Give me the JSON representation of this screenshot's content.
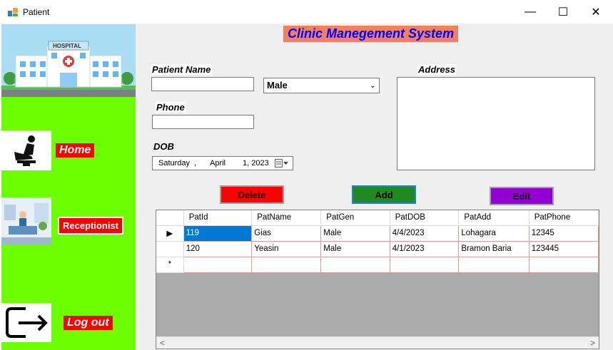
{
  "window": {
    "title": "Patient",
    "minimize": "—",
    "maximize": "☐",
    "close": "✕"
  },
  "hospital_image": {
    "sign_text": "HOSPITAL"
  },
  "sidebar": {
    "items": [
      {
        "label": "Home",
        "icon": "person-at-desk-icon"
      },
      {
        "label": "Receptionist",
        "icon": "receptionist-illustration-icon"
      },
      {
        "label": "Log out",
        "icon": "logout-icon"
      }
    ]
  },
  "header": {
    "title": "Clinic Manegement System"
  },
  "form": {
    "patient_name": {
      "label": "Patient Name",
      "value": ""
    },
    "gender": {
      "value": "Male"
    },
    "address": {
      "label": "Address",
      "value": ""
    },
    "phone": {
      "label": "Phone",
      "value": ""
    },
    "dob": {
      "label": "DOB",
      "weekday": "Saturday",
      "sep": ",",
      "month": "April",
      "day_year": "1, 2023"
    }
  },
  "buttons": {
    "delete": "Delete",
    "add": "Add",
    "edit": "Edit"
  },
  "table": {
    "columns": [
      "PatId",
      "PatName",
      "PatGen",
      "PatDOB",
      "PatAdd",
      "PatPhone"
    ],
    "rows": [
      {
        "indicator": "▶",
        "cells": [
          "119",
          "Gias",
          "Male",
          "4/4/2023",
          "Lohagara",
          "12345"
        ]
      },
      {
        "indicator": "",
        "cells": [
          "120",
          "Yeasin",
          "Male",
          "4/1/2023",
          "Bramon Baria",
          "123445"
        ]
      }
    ],
    "new_row_indicator": "*",
    "scroll_left": "<",
    "scroll_right": ">"
  },
  "colors": {
    "sidebar": "#6cff00",
    "header_bg": "#f08060",
    "header_text": "#0000ff",
    "delete": "#ff0000",
    "add": "#1f8a1f",
    "edit": "#9400d3",
    "selection": "#0078d7"
  }
}
